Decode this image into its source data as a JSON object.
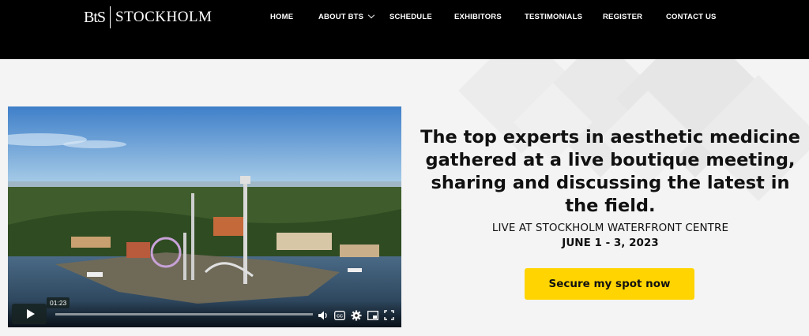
{
  "header": {
    "logo_mark": "BtS",
    "logo_text": "STOCKHOLM",
    "nav": [
      {
        "label": "HOME"
      },
      {
        "label": "ABOUT BTS",
        "has_dropdown": true
      },
      {
        "label": "SCHEDULE"
      },
      {
        "label": "EXHIBITORS"
      },
      {
        "label": "TESTIMONIALS"
      },
      {
        "label": "REGISTER"
      },
      {
        "label": "CONTACT US"
      }
    ]
  },
  "video": {
    "time": "01:23",
    "progress_fraction": 0.0,
    "controls": [
      "play-icon",
      "volume-icon",
      "captions-icon",
      "settings-icon",
      "pip-icon",
      "fullscreen-icon"
    ]
  },
  "hero": {
    "headline": "The top experts in aesthetic medicine gathered at a live boutique meeting, sharing and discussing the latest in the field.",
    "venue": "LIVE AT STOCKHOLM WATERFRONT CENTRE",
    "dates": "JUNE 1 - 3, 2023",
    "cta_label": "Secure my spot now"
  },
  "colors": {
    "header_bg": "#000000",
    "page_bg": "#f4f4f4",
    "cta_bg": "#ffd400",
    "text": "#111111"
  }
}
